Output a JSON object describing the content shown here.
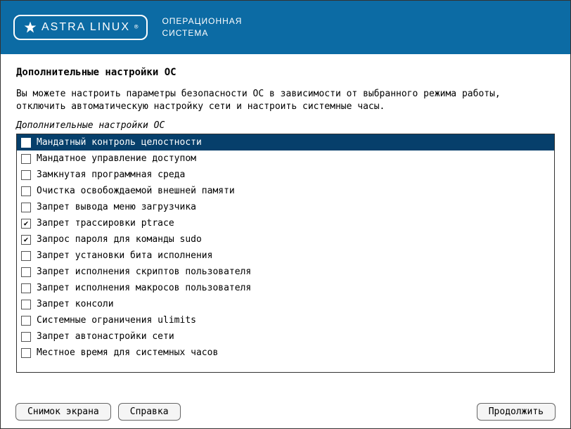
{
  "header": {
    "logo_text": "ASTRA LINUX",
    "title_line1": "ОПЕРАЦИОННАЯ",
    "title_line2": "СИСТЕМА"
  },
  "page": {
    "title": "Дополнительные настройки ОС",
    "description": "Вы можете настроить параметры безопасности ОС в зависимости от выбранного режима работы, отключить автоматическую настройку сети и настроить системные часы.",
    "section_label": "Дополнительные настройки ОС"
  },
  "options": [
    {
      "label": "Мандатный контроль целостности",
      "checked": false,
      "selected": true
    },
    {
      "label": "Мандатное управление доступом",
      "checked": false,
      "selected": false
    },
    {
      "label": "Замкнутая программная среда",
      "checked": false,
      "selected": false
    },
    {
      "label": "Очистка освобождаемой внешней памяти",
      "checked": false,
      "selected": false
    },
    {
      "label": "Запрет вывода меню загрузчика",
      "checked": false,
      "selected": false
    },
    {
      "label": "Запрет трассировки ptrace",
      "checked": true,
      "selected": false
    },
    {
      "label": "Запрос пароля для команды sudo",
      "checked": true,
      "selected": false
    },
    {
      "label": "Запрет установки бита исполнения",
      "checked": false,
      "selected": false
    },
    {
      "label": "Запрет исполнения скриптов пользователя",
      "checked": false,
      "selected": false
    },
    {
      "label": "Запрет исполнения макросов пользователя",
      "checked": false,
      "selected": false
    },
    {
      "label": "Запрет консоли",
      "checked": false,
      "selected": false
    },
    {
      "label": "Системные ограничения ulimits",
      "checked": false,
      "selected": false
    },
    {
      "label": "Запрет автонастройки сети",
      "checked": false,
      "selected": false
    },
    {
      "label": "Местное время для системных часов",
      "checked": false,
      "selected": false
    }
  ],
  "footer": {
    "screenshot": "Снимок экрана",
    "help": "Справка",
    "continue": "Продолжить"
  }
}
